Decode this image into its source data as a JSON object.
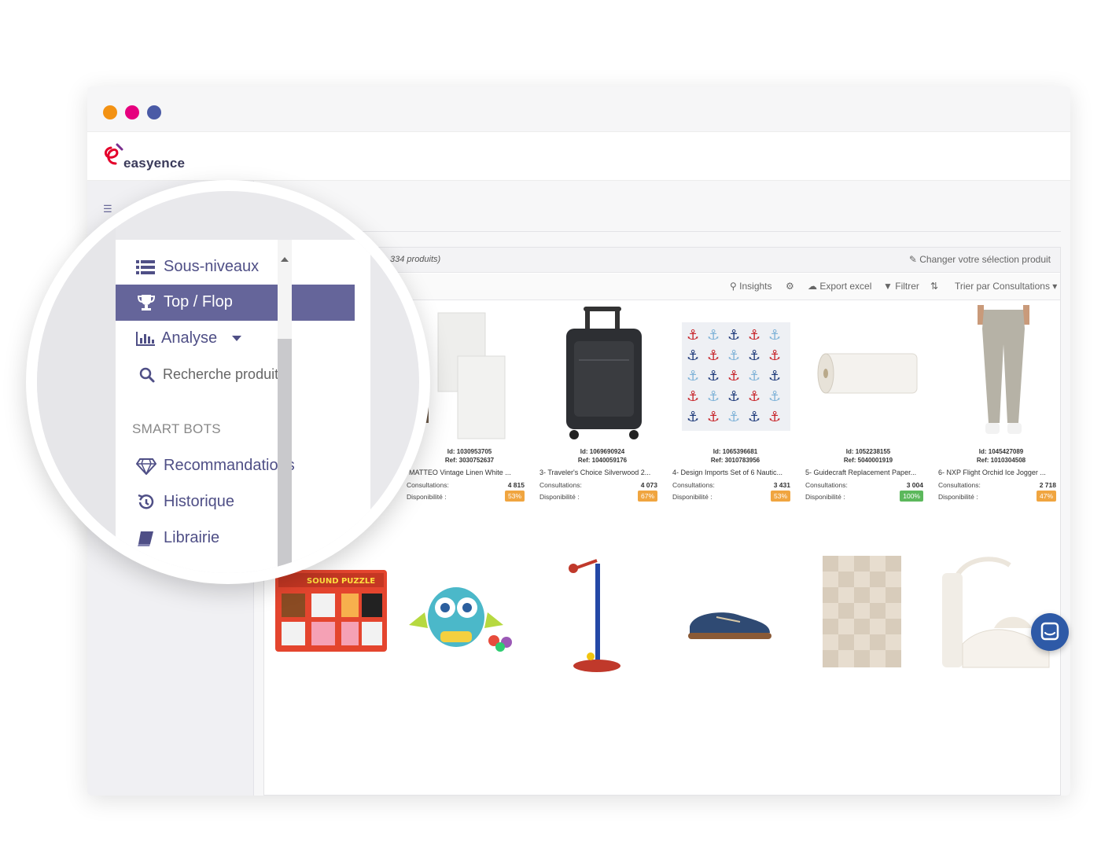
{
  "window": {
    "dots": [
      "#f39213",
      "#e6007e",
      "#4a5aa6"
    ]
  },
  "brand": {
    "name": "easyence",
    "colors": {
      "accent": "#65659a",
      "logo_red": "#e4002b",
      "logo_purple": "#7a2f8e"
    }
  },
  "left_panel": {
    "top_icon": "list-icon"
  },
  "menu": {
    "items": [
      {
        "label": "Sous-niveaux",
        "icon": "list-icon",
        "active": false
      },
      {
        "label": "Top / Flop",
        "icon": "trophy-icon",
        "active": true
      },
      {
        "label": "Analyse",
        "icon": "bar-chart-icon",
        "active": false,
        "has_dropdown": true
      },
      {
        "label": "Recherche produit",
        "icon": "search-icon",
        "active": false
      }
    ],
    "section_title": "SMART BOTS",
    "bots": [
      {
        "label": "Recommandations",
        "icon": "diamond-icon"
      },
      {
        "label": "Historique",
        "icon": "history-icon"
      },
      {
        "label": "Librairie",
        "icon": "book-icon"
      }
    ]
  },
  "panel": {
    "count_text": "334 produits)",
    "change_selection": "Changer votre sélection produit"
  },
  "toolbar": {
    "insights": "Insights",
    "export": "Export excel",
    "filter": "Filtrer",
    "sort": "Trier par Consultations"
  },
  "labels": {
    "consultations": "Consultations:",
    "availability": "Disponibilité :"
  },
  "products": [
    {
      "id": "Id: 1030953705",
      "ref": "Ref: 3030752637",
      "name": "-MATTEO Vintage Linen White ...",
      "consultations": "4 815",
      "availability": "53%",
      "badge_color": "#f0a540",
      "image": "towel"
    },
    {
      "id": "Id: 1069690924",
      "ref": "Ref: 1040059176",
      "name": "3- Traveler's Choice Silverwood 2...",
      "consultations": "4 073",
      "availability": "67%",
      "badge_color": "#f0a540",
      "image": "suitcase"
    },
    {
      "id": "Id: 1065396681",
      "ref": "Ref: 3010783956",
      "name": "4- Design Imports Set of 6 Nautic...",
      "consultations": "3 431",
      "availability": "53%",
      "badge_color": "#f0a540",
      "image": "anchors"
    },
    {
      "id": "Id: 1052238155",
      "ref": "Ref: 5040001919",
      "name": "5- Guidecraft Replacement Paper...",
      "consultations": "3 004",
      "availability": "100%",
      "badge_color": "#5cb85c",
      "image": "paper-roll"
    },
    {
      "id": "Id: 1045427089",
      "ref": "Ref: 1010304508",
      "name": "6- NXP Flight Orchid Ice Jogger ...",
      "consultations": "2 718",
      "availability": "47%",
      "badge_color": "#f0a540",
      "image": "jogger"
    }
  ],
  "second_row_images": [
    "puzzle-image",
    "owl-toy-image",
    "microphone-stand-image",
    "shoe-image",
    "rug-image",
    "sandal-image"
  ],
  "chat": {
    "icon": "chat-icon"
  }
}
